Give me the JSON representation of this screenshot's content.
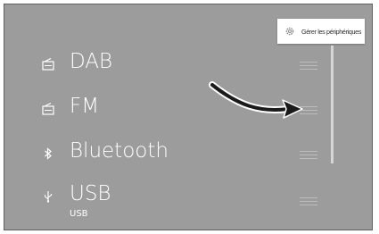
{
  "header": {
    "manage_devices_label": "Gérer les périphériques"
  },
  "sources": [
    {
      "name": "DAB",
      "sub": "",
      "icon": "radio-icon"
    },
    {
      "name": "FM",
      "sub": "",
      "icon": "radio-icon"
    },
    {
      "name": "Bluetooth",
      "sub": "",
      "icon": "bluetooth-icon"
    },
    {
      "name": "USB",
      "sub": "USB",
      "icon": "usb-icon"
    }
  ],
  "colors": {
    "screen_bg": "#9c9c9c",
    "text": "#ffffff",
    "arrow": "#1a1a1a"
  }
}
